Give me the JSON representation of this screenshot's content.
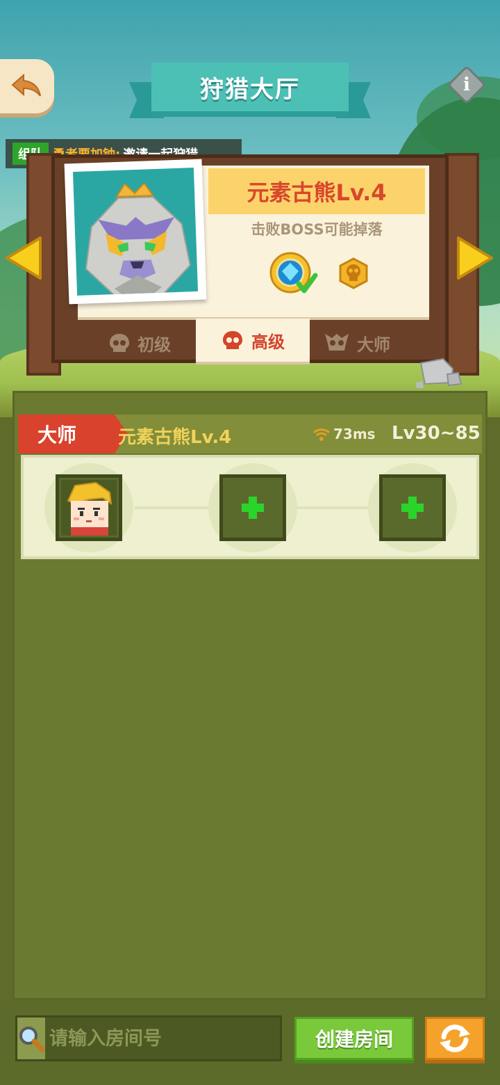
{
  "header": {
    "title": "狩猎大厅",
    "info_symbol": "i"
  },
  "ticker": {
    "tag": "组队",
    "user": "勇者要加钟:",
    "message": "邀请一起狩猎..."
  },
  "boss_card": {
    "name": "元素古熊Lv.4",
    "drop_label": "击败BOSS可能掉落",
    "drops": [
      "gem-medal-icon",
      "skull-coin-icon"
    ]
  },
  "difficulty_tabs": [
    {
      "label": "初级",
      "icon": "skull-icon",
      "selected": false
    },
    {
      "label": "高级",
      "icon": "skull-icon",
      "selected": true
    },
    {
      "label": "大师",
      "icon": "demon-skull-icon",
      "selected": false
    }
  ],
  "rooms": [
    {
      "badge": "大师",
      "boss": "元素古熊Lv.4",
      "ping": "73ms",
      "level_range": "Lv30~85",
      "slots": [
        "player-avatar",
        "empty",
        "empty"
      ]
    }
  ],
  "bottom": {
    "search_placeholder": "请输入房间号",
    "create_label": "创建房间"
  },
  "colors": {
    "accent_teal": "#4cc0b5",
    "badge_red": "#d9422c",
    "create_green": "#79c93a",
    "refresh_orange": "#f5a22c"
  }
}
